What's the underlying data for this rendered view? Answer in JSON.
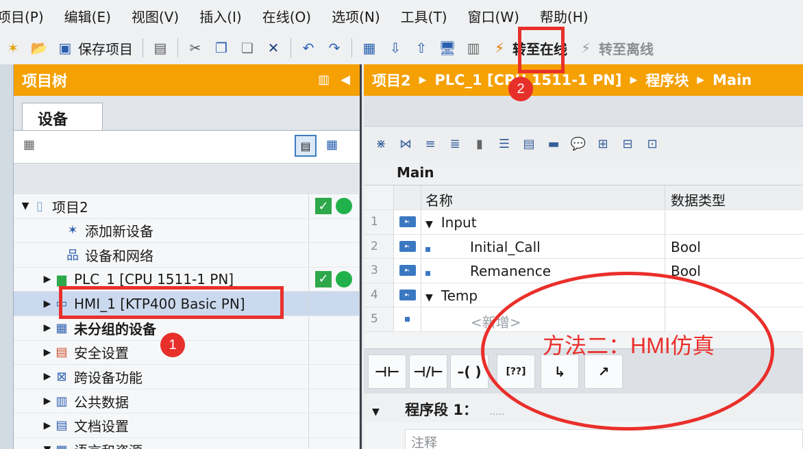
{
  "menu": [
    "项目(P)",
    "编辑(E)",
    "视图(V)",
    "插入(I)",
    "在线(O)",
    "选项(N)",
    "工具(T)",
    "窗口(W)",
    "帮助(H)"
  ],
  "toolbar": {
    "save_label": "保存项目",
    "go_online": "转至在线",
    "go_offline": "转至离线"
  },
  "tree_panel": {
    "title": "项目树",
    "tab_devices": "设备",
    "items": [
      {
        "label": "项目2",
        "status": true
      },
      {
        "label": "添加新设备"
      },
      {
        "label": "设备和网络"
      },
      {
        "label": "PLC_1 [CPU 1511-1 PN]",
        "status": true
      },
      {
        "label": "HMI_1 [KTP400 Basic PN]"
      },
      {
        "label": "未分组的设备"
      },
      {
        "label": "安全设置"
      },
      {
        "label": "跨设备功能"
      },
      {
        "label": "公共数据"
      },
      {
        "label": "文档设置"
      },
      {
        "label": "语言和资源"
      }
    ]
  },
  "editor": {
    "breadcrumb": [
      "项目2",
      "PLC_1 [CPU 1511-1 PN]",
      "程序块",
      "Main"
    ],
    "block_name": "Main",
    "columns": {
      "name": "名称",
      "type": "数据类型"
    },
    "rows": [
      {
        "num": "1",
        "name": "Input",
        "type": ""
      },
      {
        "num": "2",
        "name": "Initial_Call",
        "type": "Bool"
      },
      {
        "num": "3",
        "name": "Remanence",
        "type": "Bool"
      },
      {
        "num": "4",
        "name": "Temp",
        "type": ""
      },
      {
        "num": "5",
        "name": "<新增>",
        "type": ""
      }
    ],
    "network_label": "程序段 1：",
    "network_dots": ".....",
    "comment_placeholder": "注释"
  },
  "annotations": {
    "badge_1": "1",
    "badge_2": "2",
    "method_text": "方法二：HMI仿真"
  },
  "colors": {
    "accent": "#f5a003",
    "annotation": "#e8302b",
    "status_green": "#21b14b"
  }
}
